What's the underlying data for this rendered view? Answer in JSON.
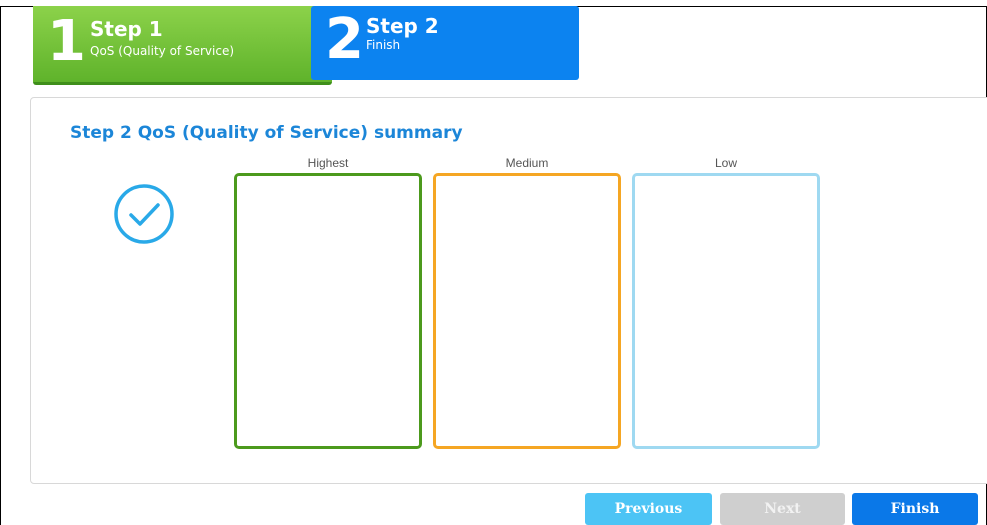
{
  "wizard": {
    "steps": [
      {
        "number": "1",
        "title": "Step 1",
        "subtitle": "QoS (Quality of Service)"
      },
      {
        "number": "2",
        "title": "Step 2",
        "subtitle": "Finish"
      }
    ]
  },
  "summary": {
    "title": "Step 2 QoS (Quality of Service) summary",
    "status_icon": "check-circle-icon",
    "columns": [
      {
        "label": "Highest",
        "color": "#4c9a1d"
      },
      {
        "label": "Medium",
        "color": "#f5a623"
      },
      {
        "label": "Low",
        "color": "#9fd9f1"
      }
    ]
  },
  "buttons": {
    "previous": "Previous",
    "next": "Next",
    "finish": "Finish"
  },
  "colors": {
    "step_active": "#6abf33",
    "step_current": "#0c83f0",
    "accent_text": "#1c86d8"
  }
}
